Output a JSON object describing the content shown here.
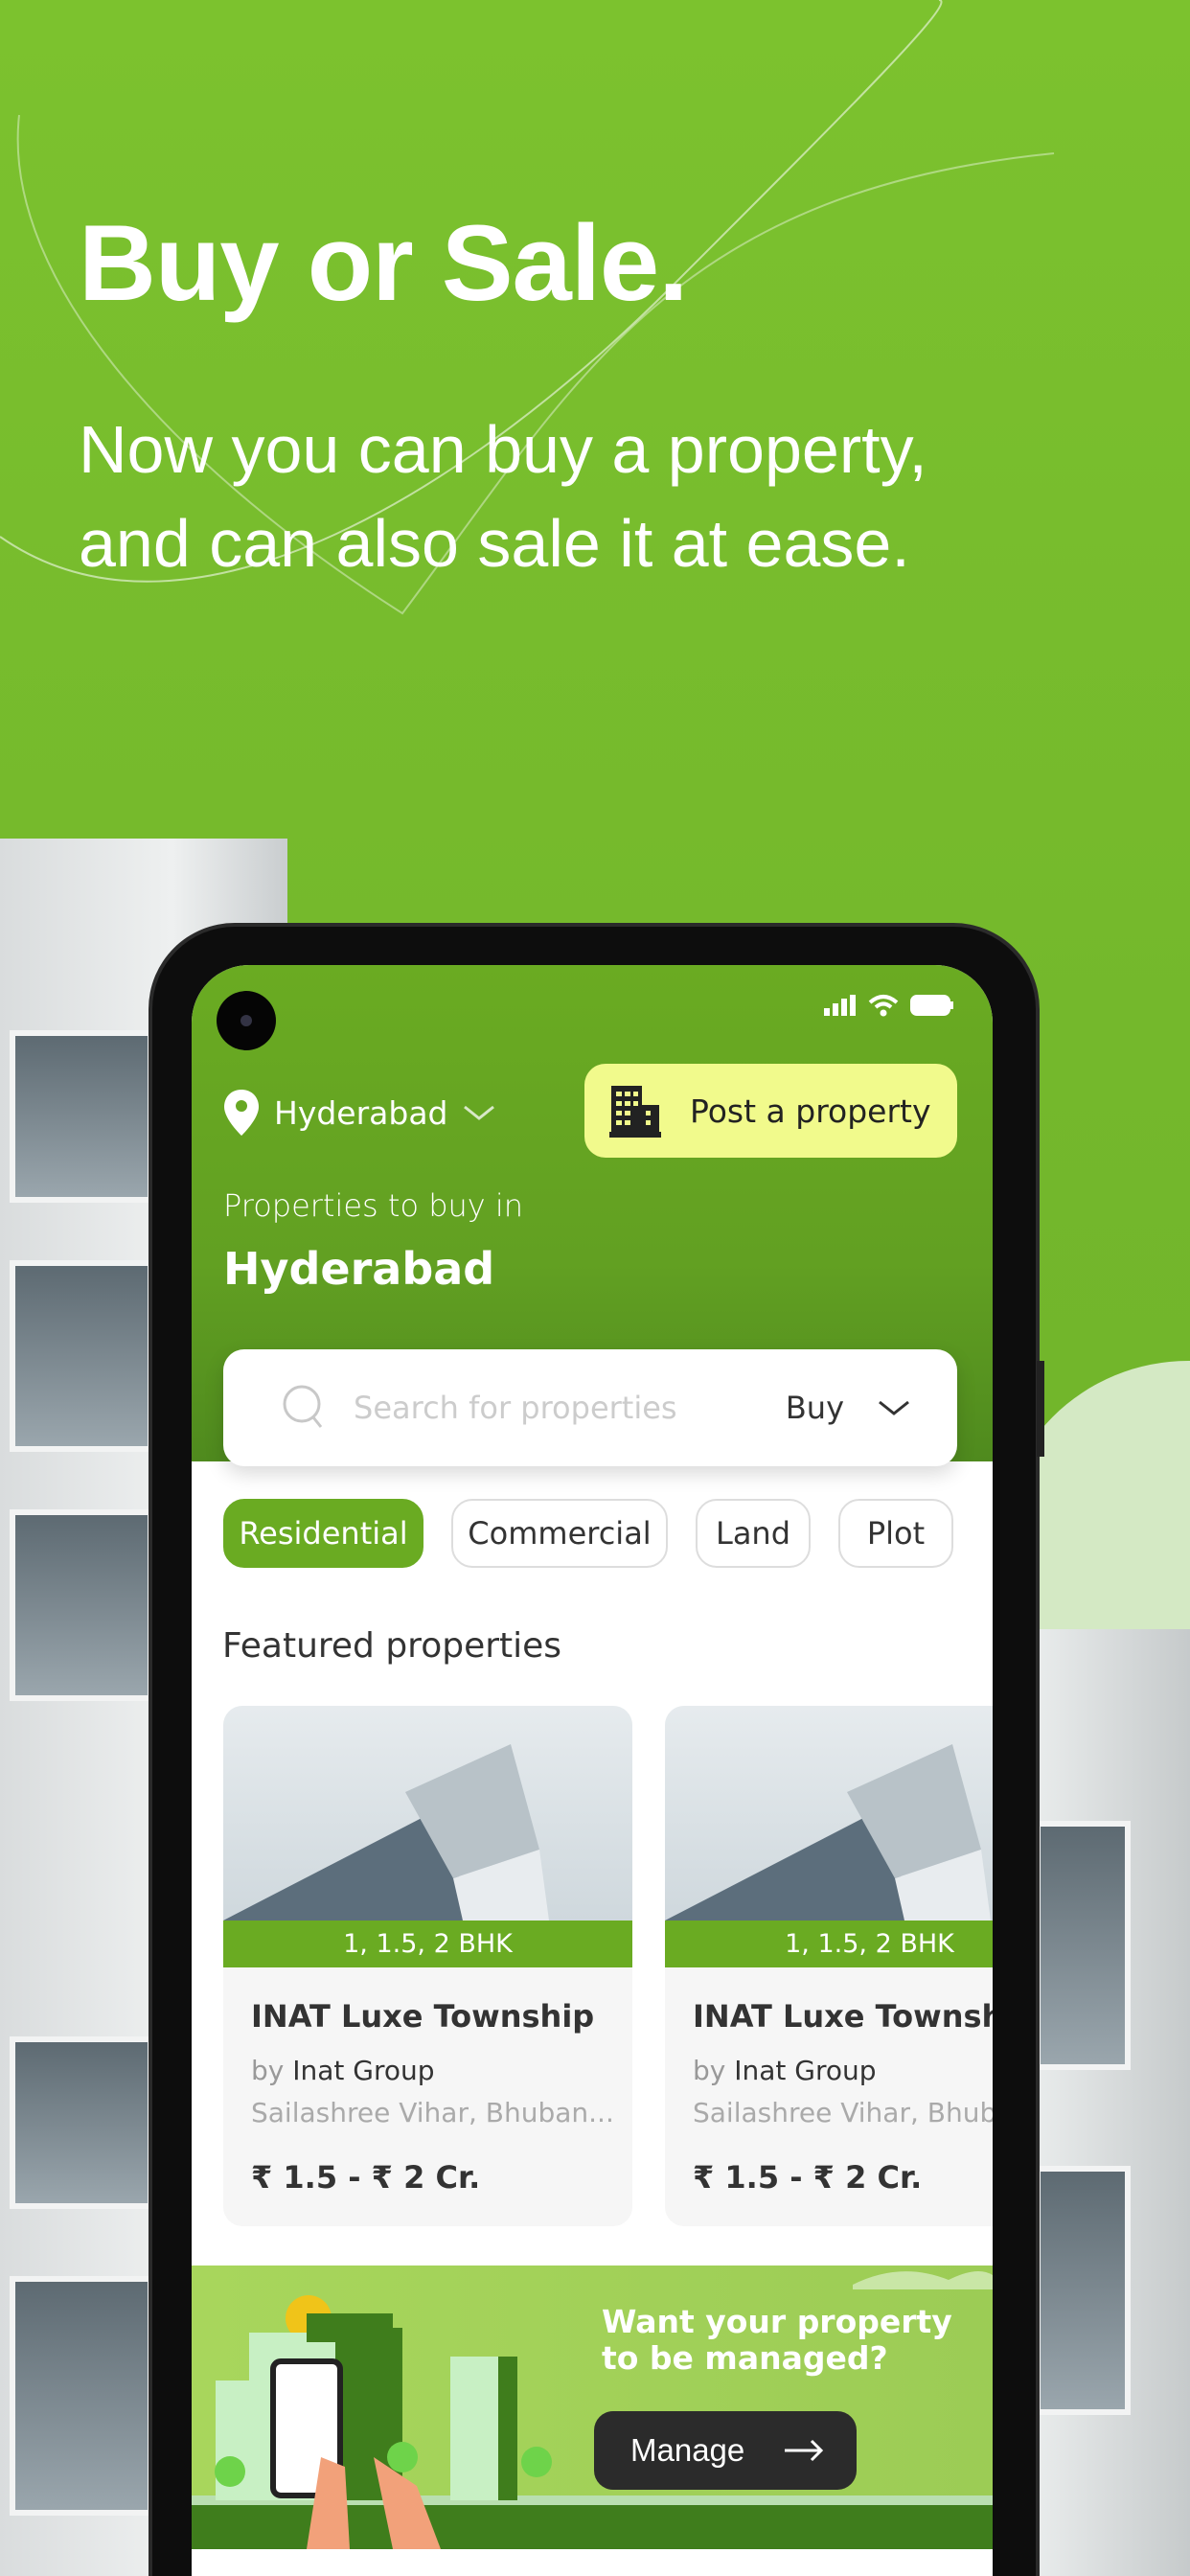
{
  "hero": {
    "title": "Buy or Sale.",
    "subtitle_line1": "Now you can buy a property,",
    "subtitle_line2": "and can also sale it at ease."
  },
  "colors": {
    "brand_green": "#6aab22",
    "post_button": "#f1fa8c",
    "manage_button": "#2b2b2b"
  },
  "app": {
    "location": {
      "icon": "map-pin-icon",
      "city": "Hyderabad",
      "chevron": "chevron-down-icon"
    },
    "post_button": {
      "icon": "building-icon",
      "label": "Post a property"
    },
    "header_label": "Properties to buy in",
    "header_city": "Hyderabad",
    "search": {
      "placeholder": "Search for properties",
      "mode": "Buy"
    },
    "chips": [
      {
        "label": "Residential",
        "active": true
      },
      {
        "label": "Commercial"
      },
      {
        "label": "Land"
      },
      {
        "label": "Plot"
      }
    ],
    "featured_title": "Featured properties",
    "cards": [
      {
        "tag": "1, 1.5, 2 BHK",
        "title": "INAT Luxe Township",
        "by": "by",
        "developer": "Inat Group",
        "address": "Sailashree Vihar, Bhuban...",
        "price": "₹ 1.5 - ₹ 2 Cr."
      },
      {
        "tag": "1, 1.5, 2 BHK",
        "title": "INAT Luxe Township",
        "by": "by",
        "developer": "Inat Group",
        "address": "Sailashree Vihar, Bhuba",
        "price": "₹ 1.5 - ₹ 2 Cr."
      }
    ],
    "banner": {
      "line1": "Want your property",
      "line2": "to be managed?",
      "button": "Manage"
    }
  }
}
